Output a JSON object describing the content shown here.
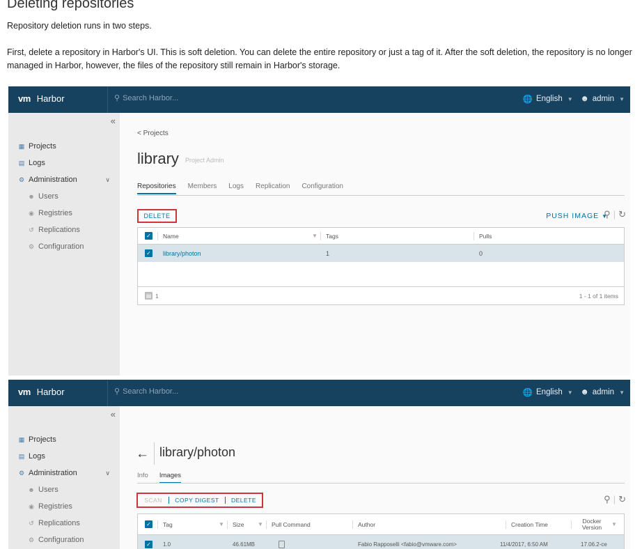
{
  "doc": {
    "heading": "Deleting repositories",
    "intro": "Repository deletion runs in two steps.",
    "paragraph": "First, delete a repository in Harbor's UI. This is soft deletion. You can delete the entire repository or just a tag of it. After the soft deletion, the repository is no longer managed in Harbor, however, the files of the repository still remain in Harbor's storage."
  },
  "header": {
    "logo": "vm",
    "app_name": "Harbor",
    "search_placeholder": "Search Harbor...",
    "language": "English",
    "user": "admin"
  },
  "sidebar": {
    "collapse": "«",
    "items": [
      {
        "label": "Projects"
      },
      {
        "label": "Logs"
      },
      {
        "label": "Administration"
      }
    ],
    "sub_items": [
      {
        "label": "Users"
      },
      {
        "label": "Registries"
      },
      {
        "label": "Replications"
      },
      {
        "label": "Configuration"
      }
    ]
  },
  "project": {
    "breadcrumb": "< Projects",
    "title": "library",
    "role": "Project Admin",
    "tabs": [
      "Repositories",
      "Members",
      "Logs",
      "Replication",
      "Configuration"
    ],
    "delete_label": "DELETE",
    "push_label": "PUSH IMAGE",
    "columns": [
      "Name",
      "Tags",
      "Pulls"
    ],
    "row": {
      "name": "library/photon",
      "tags": "1",
      "pulls": "0"
    },
    "footer_count": "1",
    "pagination": "1 - 1 of 1 items"
  },
  "images": {
    "title": "library/photon",
    "tabs": [
      "Info",
      "Images"
    ],
    "scan_label": "SCAN",
    "copy_digest_label": "COPY DIGEST",
    "delete_label": "DELETE",
    "columns": [
      "Tag",
      "Size",
      "Pull Command",
      "Author",
      "Creation Time",
      "Docker Version"
    ],
    "row": {
      "tag": "1.0",
      "size": "46.61MB",
      "author": "Fabio Rapposelli <fabio@vmware.com>",
      "created": "11/4/2017, 6:50 AM",
      "docker_version": "17.06.2-ce"
    }
  },
  "colors": {
    "header": "#17425f",
    "accent": "#0072a3",
    "highlight": "#d1333c",
    "selected_row": "#d8e4ea"
  }
}
